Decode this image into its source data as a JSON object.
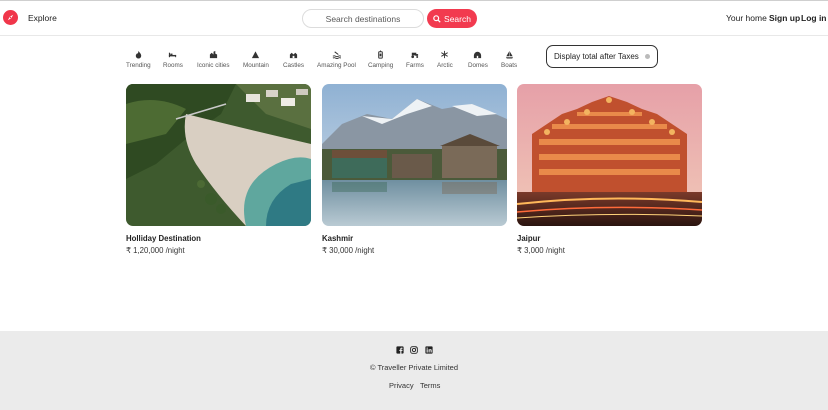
{
  "nav": {
    "explore": "Explore",
    "search_placeholder": "Search destinations",
    "search_button": "Search",
    "your_home": "Your home",
    "sign_up": "Sign up",
    "log_in": "Log in"
  },
  "categories": [
    {
      "label": "Trending",
      "icon": "fire-icon"
    },
    {
      "label": "Rooms",
      "icon": "bed-icon"
    },
    {
      "label": "Iconic cities",
      "icon": "city-icon"
    },
    {
      "label": "Mountain",
      "icon": "mountain-icon"
    },
    {
      "label": "Castles",
      "icon": "castle-icon"
    },
    {
      "label": "Amazing Pool",
      "icon": "pool-icon"
    },
    {
      "label": "Camping",
      "icon": "lantern-icon"
    },
    {
      "label": "Farms",
      "icon": "tractor-icon"
    },
    {
      "label": "Arctic",
      "icon": "snowflake-icon"
    },
    {
      "label": "Domes",
      "icon": "dome-icon"
    },
    {
      "label": "Boats",
      "icon": "sailboat-icon"
    }
  ],
  "taxes_toggle": "Display total after Taxes",
  "listings": [
    {
      "title": "Holliday Destination",
      "price": "₹ 1,20,000 /night"
    },
    {
      "title": "Kashmir",
      "price": "₹ 30,000 /night"
    },
    {
      "title": "Jaipur",
      "price": "₹ 3,000 /night"
    }
  ],
  "footer": {
    "social": [
      "facebook-icon",
      "instagram-icon",
      "linkedin-icon"
    ],
    "copyright": "© Traveller Private Limited",
    "privacy": "Privacy",
    "terms": "Terms"
  },
  "colors": {
    "brand": "#f23a4f",
    "footer_bg": "#ebebeb"
  }
}
